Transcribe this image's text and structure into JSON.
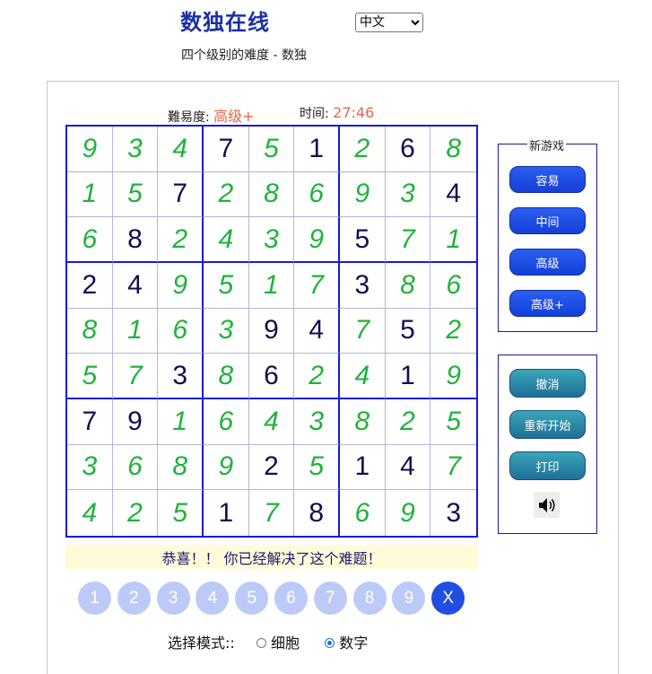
{
  "header": {
    "site_title": "数独在线",
    "language": "中文",
    "subtitle": "四个级别的难度 - 数独"
  },
  "status": {
    "difficulty_label": "難易度:",
    "difficulty_value": "高级+",
    "time_label": "时间:",
    "time_value": "27:46"
  },
  "board": [
    [
      {
        "v": "9",
        "t": "u"
      },
      {
        "v": "3",
        "t": "u"
      },
      {
        "v": "4",
        "t": "u"
      },
      {
        "v": "7",
        "t": "g"
      },
      {
        "v": "5",
        "t": "u"
      },
      {
        "v": "1",
        "t": "g"
      },
      {
        "v": "2",
        "t": "u"
      },
      {
        "v": "6",
        "t": "g"
      },
      {
        "v": "8",
        "t": "u"
      }
    ],
    [
      {
        "v": "1",
        "t": "u"
      },
      {
        "v": "5",
        "t": "u"
      },
      {
        "v": "7",
        "t": "g"
      },
      {
        "v": "2",
        "t": "u"
      },
      {
        "v": "8",
        "t": "u"
      },
      {
        "v": "6",
        "t": "u"
      },
      {
        "v": "9",
        "t": "u"
      },
      {
        "v": "3",
        "t": "u"
      },
      {
        "v": "4",
        "t": "g"
      }
    ],
    [
      {
        "v": "6",
        "t": "u"
      },
      {
        "v": "8",
        "t": "g"
      },
      {
        "v": "2",
        "t": "u"
      },
      {
        "v": "4",
        "t": "u"
      },
      {
        "v": "3",
        "t": "u"
      },
      {
        "v": "9",
        "t": "u"
      },
      {
        "v": "5",
        "t": "g"
      },
      {
        "v": "7",
        "t": "u"
      },
      {
        "v": "1",
        "t": "u"
      }
    ],
    [
      {
        "v": "2",
        "t": "g"
      },
      {
        "v": "4",
        "t": "g"
      },
      {
        "v": "9",
        "t": "u"
      },
      {
        "v": "5",
        "t": "u"
      },
      {
        "v": "1",
        "t": "u"
      },
      {
        "v": "7",
        "t": "u"
      },
      {
        "v": "3",
        "t": "g"
      },
      {
        "v": "8",
        "t": "u"
      },
      {
        "v": "6",
        "t": "u"
      }
    ],
    [
      {
        "v": "8",
        "t": "u"
      },
      {
        "v": "1",
        "t": "u"
      },
      {
        "v": "6",
        "t": "u"
      },
      {
        "v": "3",
        "t": "u"
      },
      {
        "v": "9",
        "t": "g"
      },
      {
        "v": "4",
        "t": "g"
      },
      {
        "v": "7",
        "t": "u"
      },
      {
        "v": "5",
        "t": "g"
      },
      {
        "v": "2",
        "t": "u"
      }
    ],
    [
      {
        "v": "5",
        "t": "u"
      },
      {
        "v": "7",
        "t": "u"
      },
      {
        "v": "3",
        "t": "g"
      },
      {
        "v": "8",
        "t": "u"
      },
      {
        "v": "6",
        "t": "g"
      },
      {
        "v": "2",
        "t": "u"
      },
      {
        "v": "4",
        "t": "u"
      },
      {
        "v": "1",
        "t": "g"
      },
      {
        "v": "9",
        "t": "u"
      }
    ],
    [
      {
        "v": "7",
        "t": "g"
      },
      {
        "v": "9",
        "t": "g"
      },
      {
        "v": "1",
        "t": "u"
      },
      {
        "v": "6",
        "t": "u"
      },
      {
        "v": "4",
        "t": "u"
      },
      {
        "v": "3",
        "t": "u"
      },
      {
        "v": "8",
        "t": "u"
      },
      {
        "v": "2",
        "t": "u"
      },
      {
        "v": "5",
        "t": "u"
      }
    ],
    [
      {
        "v": "3",
        "t": "u"
      },
      {
        "v": "6",
        "t": "u"
      },
      {
        "v": "8",
        "t": "u"
      },
      {
        "v": "9",
        "t": "u"
      },
      {
        "v": "2",
        "t": "g"
      },
      {
        "v": "5",
        "t": "u"
      },
      {
        "v": "1",
        "t": "g"
      },
      {
        "v": "4",
        "t": "g"
      },
      {
        "v": "7",
        "t": "u"
      }
    ],
    [
      {
        "v": "4",
        "t": "u"
      },
      {
        "v": "2",
        "t": "u"
      },
      {
        "v": "5",
        "t": "u"
      },
      {
        "v": "1",
        "t": "g"
      },
      {
        "v": "7",
        "t": "u"
      },
      {
        "v": "8",
        "t": "g"
      },
      {
        "v": "6",
        "t": "u"
      },
      {
        "v": "9",
        "t": "u"
      },
      {
        "v": "3",
        "t": "g"
      }
    ]
  ],
  "new_game": {
    "legend": "新游戏",
    "easy": "容易",
    "medium": "中间",
    "hard": "高级",
    "expert": "高级+"
  },
  "actions": {
    "undo": "撤消",
    "restart": "重新开始",
    "print": "打印"
  },
  "message": "恭喜！！ 你已经解决了这个难题！",
  "numpad": [
    "1",
    "2",
    "3",
    "4",
    "5",
    "6",
    "7",
    "8",
    "9"
  ],
  "erase_label": "X",
  "mode": {
    "label": "选择模式::",
    "option_cell": "细胞",
    "option_number": "数字",
    "selected": "数字"
  },
  "colors": {
    "given": "#101050",
    "user": "#1fb33a",
    "grid_bold": "#1a1adb",
    "accent_time": "#e8654e"
  }
}
